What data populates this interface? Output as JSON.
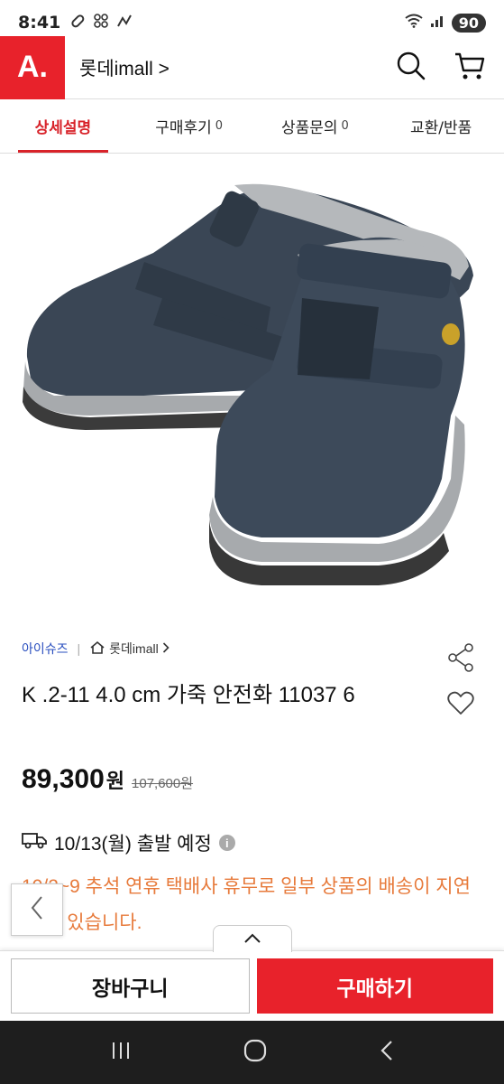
{
  "status_bar": {
    "time": "8:41",
    "battery": "90"
  },
  "header": {
    "logo": "A.",
    "mall_name": "롯데imall >"
  },
  "tabs": [
    {
      "label": "상세설명",
      "count": ""
    },
    {
      "label": "구매후기",
      "count": "0"
    },
    {
      "label": "상품문의",
      "count": "0"
    },
    {
      "label": "교환/반품",
      "count": ""
    }
  ],
  "product": {
    "brand": "아이슈즈",
    "store": "롯데imall",
    "title": "K .2-11 4.0 cm 가죽 안전화 11037 6",
    "price": "89,300",
    "price_unit": "원",
    "original_price": "107,600원"
  },
  "shipping": {
    "date_text": "10/13(월) 출발 예정",
    "notice": "10/2~9 추석 연휴 택배사 휴무로 일부 상품의 배송이 지연될 수 있습니다."
  },
  "buttons": {
    "cart": "장바구니",
    "buy": "구매하기"
  },
  "colors": {
    "brand_red": "#e8222b",
    "notice_orange": "#e77a3b",
    "brand_blue": "#2a4fbf"
  }
}
